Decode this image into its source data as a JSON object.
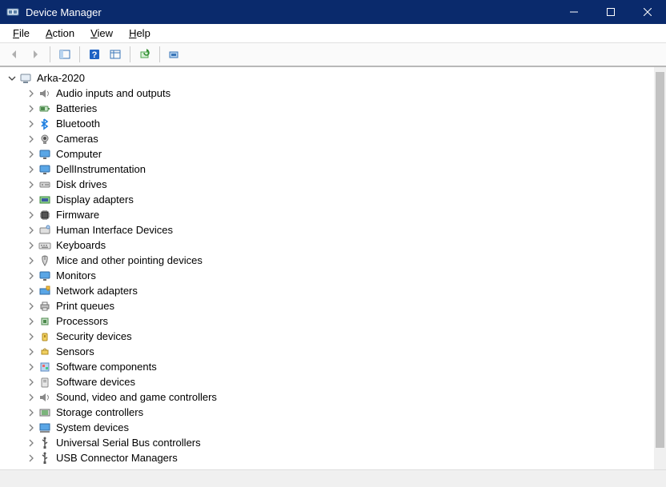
{
  "window": {
    "title": "Device Manager"
  },
  "menu": {
    "file": "File",
    "action": "Action",
    "view": "View",
    "help": "Help"
  },
  "toolbar": {
    "back": "Back",
    "forward": "Forward",
    "show_hide": "Show/Hide console tree",
    "help": "Help",
    "properties": "Properties",
    "refresh": "Scan for hardware changes",
    "add_legacy": "Add legacy hardware"
  },
  "tree": {
    "root": {
      "label": "Arka-2020",
      "icon": "computer-icon",
      "expanded": true
    },
    "categories": [
      {
        "label": "Audio inputs and outputs",
        "icon": "speaker-icon"
      },
      {
        "label": "Batteries",
        "icon": "battery-icon"
      },
      {
        "label": "Bluetooth",
        "icon": "bluetooth-icon"
      },
      {
        "label": "Cameras",
        "icon": "camera-icon"
      },
      {
        "label": "Computer",
        "icon": "monitor-icon"
      },
      {
        "label": "DellInstrumentation",
        "icon": "monitor-icon"
      },
      {
        "label": "Disk drives",
        "icon": "disk-icon"
      },
      {
        "label": "Display adapters",
        "icon": "display-adapter-icon"
      },
      {
        "label": "Firmware",
        "icon": "chip-icon"
      },
      {
        "label": "Human Interface Devices",
        "icon": "hid-icon"
      },
      {
        "label": "Keyboards",
        "icon": "keyboard-icon"
      },
      {
        "label": "Mice and other pointing devices",
        "icon": "mouse-icon"
      },
      {
        "label": "Monitors",
        "icon": "monitor-icon"
      },
      {
        "label": "Network adapters",
        "icon": "network-icon"
      },
      {
        "label": "Print queues",
        "icon": "printer-icon"
      },
      {
        "label": "Processors",
        "icon": "cpu-icon"
      },
      {
        "label": "Security devices",
        "icon": "security-icon"
      },
      {
        "label": "Sensors",
        "icon": "sensor-icon"
      },
      {
        "label": "Software components",
        "icon": "software-comp-icon"
      },
      {
        "label": "Software devices",
        "icon": "software-dev-icon"
      },
      {
        "label": "Sound, video and game controllers",
        "icon": "speaker-icon"
      },
      {
        "label": "Storage controllers",
        "icon": "storage-ctrl-icon"
      },
      {
        "label": "System devices",
        "icon": "system-icon"
      },
      {
        "label": "Universal Serial Bus controllers",
        "icon": "usb-icon"
      },
      {
        "label": "USB Connector Managers",
        "icon": "usb-icon"
      }
    ]
  },
  "colors": {
    "titlebar": "#0a2a6c",
    "accent_blue": "#1e90ff",
    "chevron": "#6a6a6a"
  }
}
